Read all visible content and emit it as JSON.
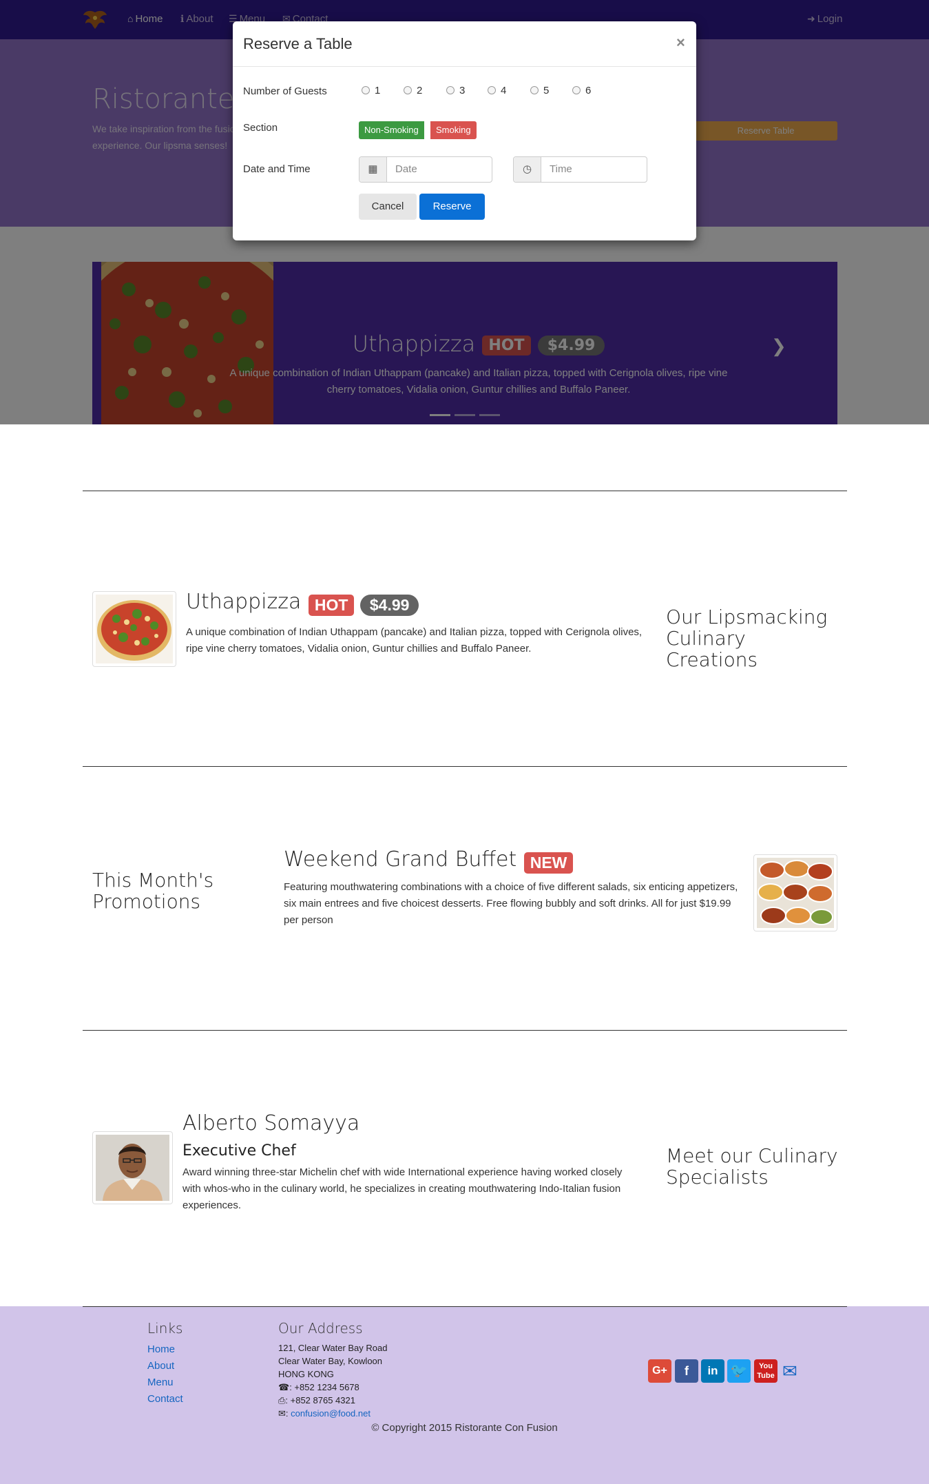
{
  "navbar": {
    "home": "Home",
    "about": "About",
    "menu": "Menu",
    "contact": "Contact",
    "login": "Login"
  },
  "jumbotron": {
    "title": "Ristorante c",
    "text": "We take inspiration from the fusion experience. Our lipsma senses!",
    "reserve_button": "Reserve Table"
  },
  "carousel": {
    "title": "Uthappizza",
    "label": "HOT",
    "price": "$4.99",
    "description": "A unique combination of Indian Uthappam (pancake) and Italian pizza, topped with Cerignola olives, ripe vine cherry tomatoes, Vidalia onion, Guntur chillies and Buffalo Paneer.",
    "next_icon": "chevron-right-icon"
  },
  "modal": {
    "title": "Reserve a Table",
    "close": "×",
    "guests_label": "Number of Guests",
    "guest_options": [
      "1",
      "2",
      "3",
      "4",
      "5",
      "6"
    ],
    "section_label": "Section",
    "section_options": [
      "Non-Smoking",
      "Smoking"
    ],
    "datetime_label": "Date and Time",
    "date_placeholder": "Date",
    "time_placeholder": "Time",
    "cancel": "Cancel",
    "reserve": "Reserve",
    "colors": {
      "non_smoking": "#3c9a41",
      "smoking": "#d9534f",
      "reserve": "#0b70d6"
    }
  },
  "dish": {
    "title": "Uthappizza",
    "label": "HOT",
    "price": "$4.99",
    "description": "A unique combination of Indian Uthappam (pancake) and Italian pizza, topped with Cerignola olives, ripe vine cherry tomatoes, Vidalia onion, Guntur chillies and Buffalo Paneer.",
    "side_heading": "Our Lipsmacking Culinary Creations"
  },
  "promotion": {
    "side_heading": "This Month's Promotions",
    "title": "Weekend Grand Buffet",
    "label": "NEW",
    "description": "Featuring mouthwatering combinations with a choice of five different salads, six enticing appetizers, six main entrees and five choicest desserts. Free flowing bubbly and soft drinks. All for just $19.99 per person"
  },
  "leader": {
    "name": "Alberto Somayya",
    "designation": "Executive Chef",
    "description": "Award winning three-star Michelin chef with wide International experience having worked closely with whos-who in the culinary world, he specializes in creating mouthwatering Indo-Italian fusion experiences.",
    "side_heading": "Meet our Culinary Specialists"
  },
  "footer": {
    "links_heading": "Links",
    "links": [
      "Home",
      "About",
      "Menu",
      "Contact"
    ],
    "address_heading": "Our Address",
    "address_lines": [
      "121, Clear Water Bay Road",
      "Clear Water Bay, Kowloon",
      "HONG KONG"
    ],
    "phone": ": +852 1234 5678",
    "fax": ": +852 8765 4321",
    "email": "confusion@food.net",
    "social": [
      "google-plus-icon",
      "facebook-icon",
      "linkedin-icon",
      "twitter-icon",
      "youtube-icon",
      "envelope-icon"
    ],
    "copyright": "© Copyright 2015 Ristorante Con Fusion"
  }
}
